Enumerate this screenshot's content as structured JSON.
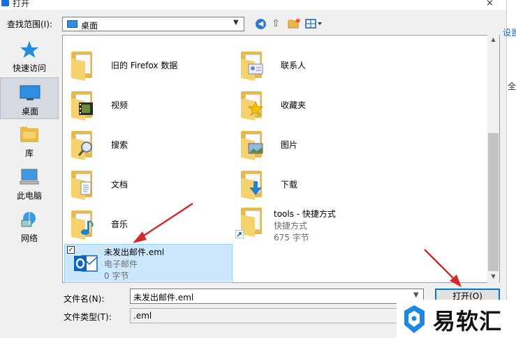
{
  "window": {
    "title": "打开",
    "close": "×"
  },
  "background_window": {
    "text1": "设置媒体",
    "text2": "全"
  },
  "toolbar": {
    "lookin_label": "查找范围(I):",
    "lookin_value": "桌面"
  },
  "places": [
    {
      "label": "快速访问",
      "icon": "star-icon"
    },
    {
      "label": "桌面",
      "icon": "desktop-icon",
      "selected": true
    },
    {
      "label": "库",
      "icon": "library-icon"
    },
    {
      "label": "此电脑",
      "icon": "computer-icon"
    },
    {
      "label": "网络",
      "icon": "network-icon"
    }
  ],
  "files": {
    "old_firefox": {
      "name": "旧的 Firefox 数据"
    },
    "contacts": {
      "name": "联系人"
    },
    "videos": {
      "name": "视频"
    },
    "favorites": {
      "name": "收藏夹"
    },
    "search": {
      "name": "搜索"
    },
    "pictures": {
      "name": "图片"
    },
    "documents": {
      "name": "文档"
    },
    "downloads": {
      "name": "下载"
    },
    "music": {
      "name": "音乐"
    },
    "tools": {
      "name": "tools - 快捷方式",
      "type": "快捷方式",
      "size": "675 字节"
    },
    "eml": {
      "name": "未发出邮件.eml",
      "type": "电子邮件",
      "size": "0 字节",
      "checked": true
    }
  },
  "bottom": {
    "filename_label": "文件名(N):",
    "filename_value": "未发出邮件.eml",
    "filetype_label": "文件类型(T):",
    "filetype_value": ".eml",
    "open_label": "打开(O)"
  },
  "watermark": {
    "text": "易软汇"
  },
  "colors": {
    "accent": "#0078d7",
    "selection": "#cce8ff",
    "folder": "#e9b948",
    "arrow": "#d62828"
  }
}
